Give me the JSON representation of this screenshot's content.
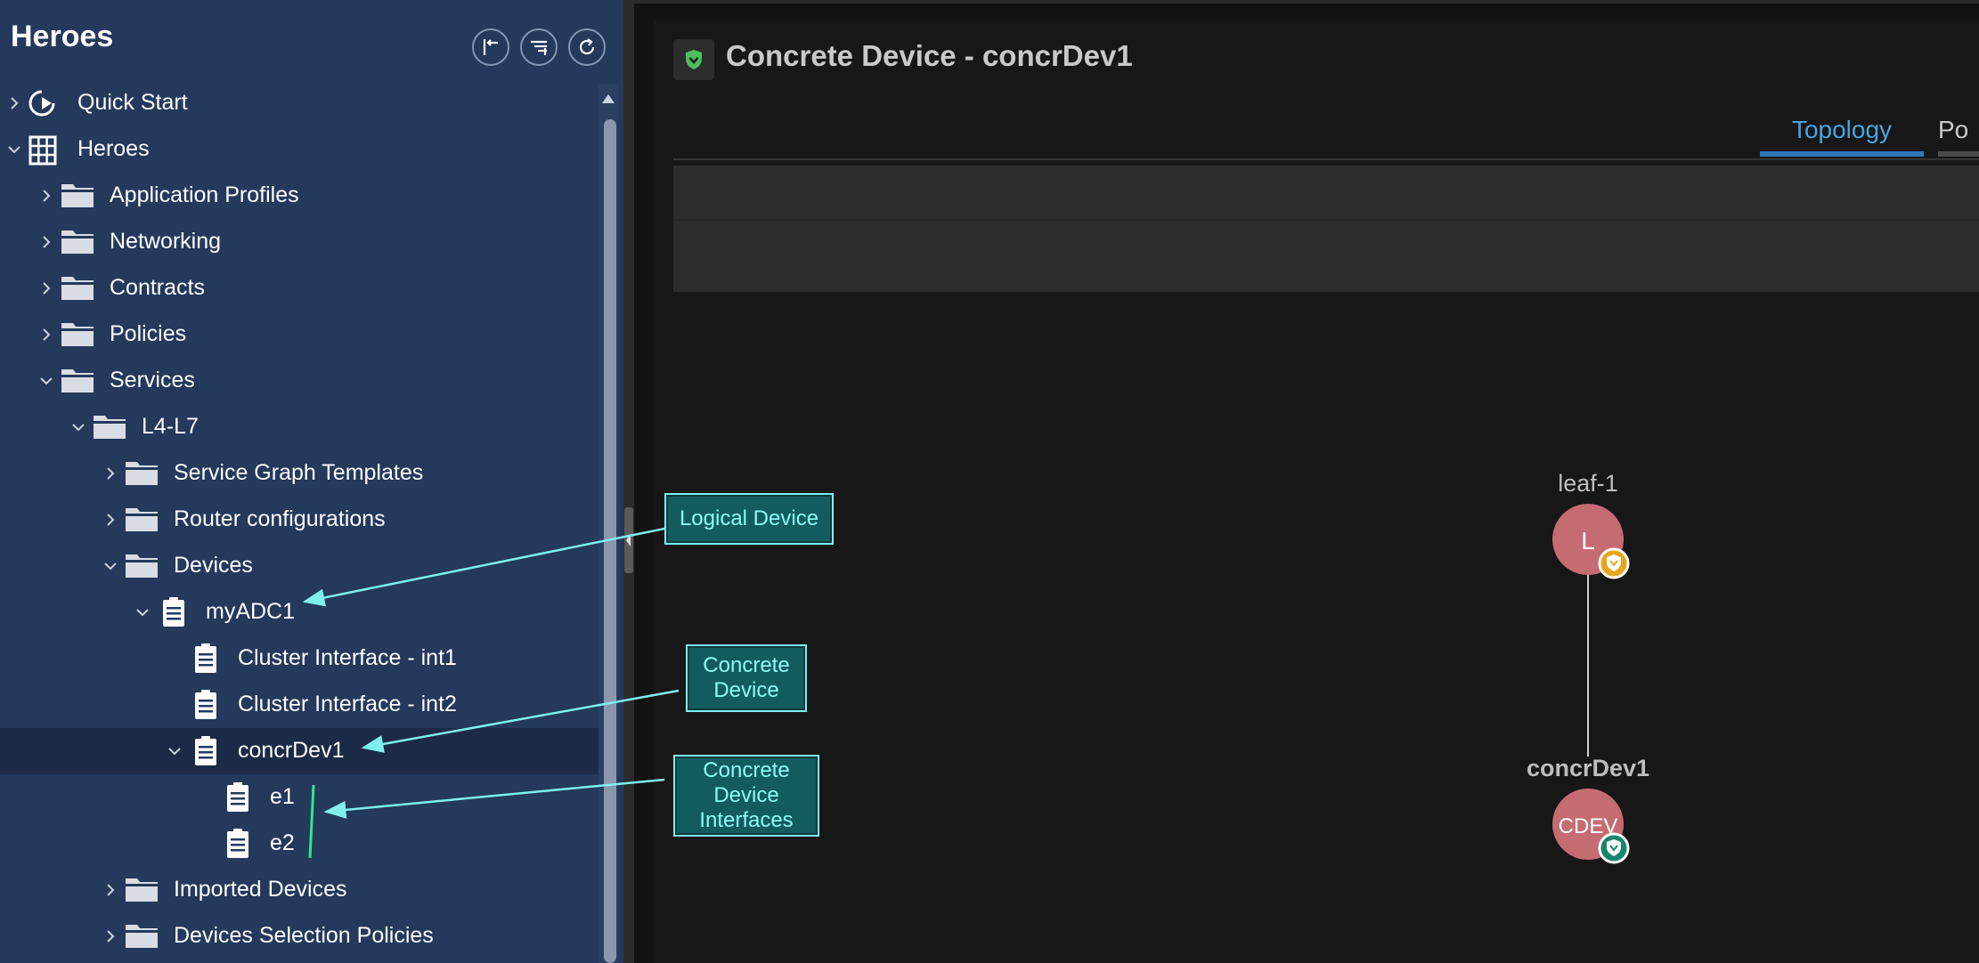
{
  "sidebar": {
    "title": "Heroes",
    "header_buttons": [
      "collapse-to-start-icon",
      "filter-list-icon",
      "refresh-icon"
    ],
    "tree": [
      {
        "label": "Quick Start",
        "icon": "quick-start-icon",
        "depth": 0,
        "chevron": "right",
        "selected": false
      },
      {
        "label": "Heroes",
        "icon": "tenant-grid-icon",
        "depth": 0,
        "chevron": "down",
        "selected": false
      },
      {
        "label": "Application Profiles",
        "icon": "folder-icon",
        "depth": 1,
        "chevron": "right",
        "selected": false
      },
      {
        "label": "Networking",
        "icon": "folder-icon",
        "depth": 1,
        "chevron": "right",
        "selected": false
      },
      {
        "label": "Contracts",
        "icon": "folder-icon",
        "depth": 1,
        "chevron": "right",
        "selected": false
      },
      {
        "label": "Policies",
        "icon": "folder-icon",
        "depth": 1,
        "chevron": "right",
        "selected": false
      },
      {
        "label": "Services",
        "icon": "folder-icon",
        "depth": 1,
        "chevron": "down",
        "selected": false
      },
      {
        "label": "L4-L7",
        "icon": "folder-icon",
        "depth": 2,
        "chevron": "down",
        "selected": false
      },
      {
        "label": "Service Graph Templates",
        "icon": "folder-icon",
        "depth": 3,
        "chevron": "right",
        "selected": false
      },
      {
        "label": "Router configurations",
        "icon": "folder-icon",
        "depth": 3,
        "chevron": "right",
        "selected": false
      },
      {
        "label": "Devices",
        "icon": "folder-icon",
        "depth": 3,
        "chevron": "down",
        "selected": false
      },
      {
        "label": "myADC1",
        "icon": "document-icon",
        "depth": 4,
        "chevron": "down",
        "selected": false
      },
      {
        "label": "Cluster Interface - int1",
        "icon": "document-icon",
        "depth": 5,
        "chevron": "none",
        "selected": false
      },
      {
        "label": "Cluster Interface - int2",
        "icon": "document-icon",
        "depth": 5,
        "chevron": "none",
        "selected": false
      },
      {
        "label": "concrDev1",
        "icon": "document-icon",
        "depth": 5,
        "chevron": "down",
        "selected": true
      },
      {
        "label": "e1",
        "icon": "document-icon",
        "depth": 6,
        "chevron": "none",
        "selected": false
      },
      {
        "label": "e2",
        "icon": "document-icon",
        "depth": 6,
        "chevron": "none",
        "selected": false
      },
      {
        "label": "Imported Devices",
        "icon": "folder-icon",
        "depth": 3,
        "chevron": "right",
        "selected": false
      },
      {
        "label": "Devices Selection Policies",
        "icon": "folder-icon",
        "depth": 3,
        "chevron": "right",
        "selected": false
      }
    ]
  },
  "main": {
    "title": "Concrete Device - concrDev1",
    "title_icon": "shield-icon",
    "tabs": [
      {
        "label": "Topology",
        "active": true
      },
      {
        "label": "Po",
        "active": false
      }
    ],
    "topology": {
      "nodes": [
        {
          "name": "leaf-1",
          "glyph": "L",
          "badge": "shield-badge-yellow-icon"
        },
        {
          "name": "concrDev1",
          "glyph": "CDEV",
          "badge": "shield-badge-green-icon"
        }
      ]
    }
  },
  "annotations": {
    "logical_device": "Logical Device",
    "concrete_device": [
      "Concrete",
      "Device"
    ],
    "concrete_device_interfaces": [
      "Concrete",
      "Device",
      "Interfaces"
    ]
  },
  "colors": {
    "sidebar_bg": "#24395c",
    "selected_row": "#1b2b47",
    "accent_tab": "#4aa3df",
    "node_fill": "#c56b72",
    "annotation": "#7ff0ef"
  }
}
